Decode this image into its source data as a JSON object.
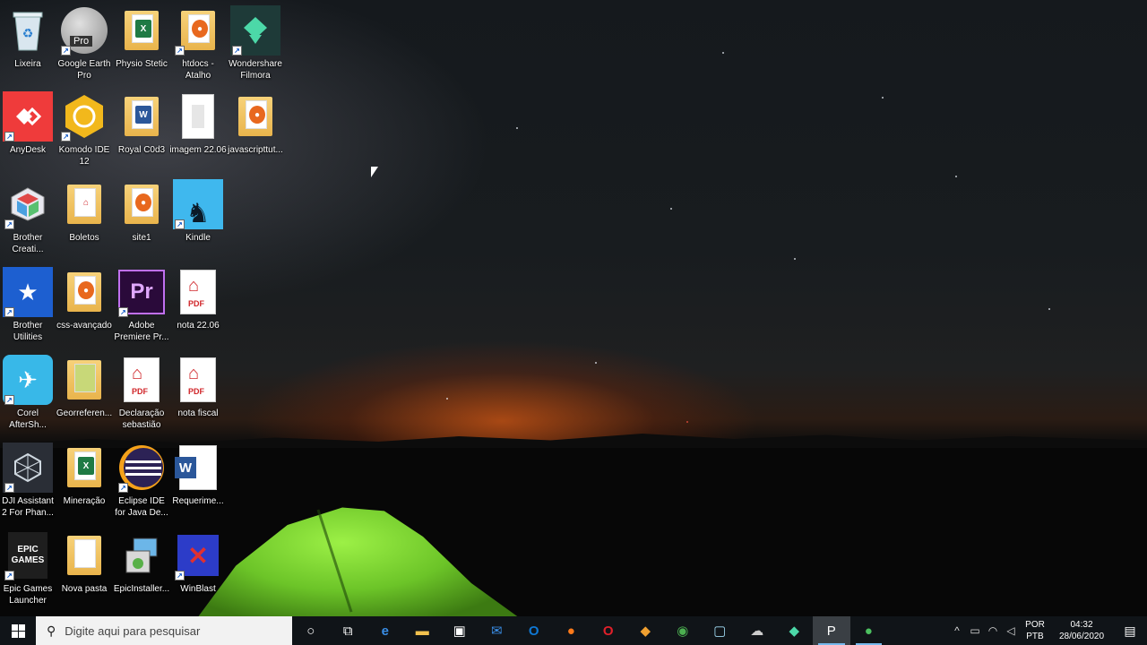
{
  "desktop": {
    "icons": [
      {
        "label": "Lixeira",
        "icon": "recycle-bin-icon"
      },
      {
        "label": "Google Earth Pro",
        "icon": "google-earth-icon",
        "badge": "Pro"
      },
      {
        "label": "Physio Stetic",
        "icon": "excel-folder-icon"
      },
      {
        "label": "htdocs - Atalho",
        "icon": "folder-shortcut-icon"
      },
      {
        "label": "Wondershare Filmora",
        "icon": "filmora-icon"
      },
      {
        "label": "AnyDesk",
        "icon": "anydesk-icon"
      },
      {
        "label": "Komodo IDE 12",
        "icon": "komodo-icon"
      },
      {
        "label": "Royal C0d3",
        "icon": "word-folder-icon"
      },
      {
        "label": "imagem 22.06",
        "icon": "image-file-icon"
      },
      {
        "label": "javascripttut...",
        "icon": "firefox-folder-icon"
      },
      {
        "label": "Brother Creati...",
        "icon": "brother-creative-icon"
      },
      {
        "label": "Boletos",
        "icon": "pdf-folder-icon"
      },
      {
        "label": "site1",
        "icon": "firefox-folder-icon"
      },
      {
        "label": "Kindle",
        "icon": "kindle-icon"
      },
      {
        "label": "Brother Utilities",
        "icon": "brother-utilities-icon"
      },
      {
        "label": "css-avançado",
        "icon": "firefox-folder-icon"
      },
      {
        "label": "Adobe Premiere Pr...",
        "icon": "premiere-icon",
        "badge": "Pr"
      },
      {
        "label": "nota 22.06",
        "icon": "pdf-icon"
      },
      {
        "label": "Corel AfterSh...",
        "icon": "corel-aftershot-icon"
      },
      {
        "label": "Georreferen...",
        "icon": "folder-icon"
      },
      {
        "label": "Declaração sebastião",
        "icon": "pdf-icon"
      },
      {
        "label": "nota fiscal",
        "icon": "pdf-icon"
      },
      {
        "label": "DJI Assistant 2 For Phan...",
        "icon": "dji-icon"
      },
      {
        "label": "Mineração",
        "icon": "excel-folder-icon"
      },
      {
        "label": "Eclipse IDE for Java De...",
        "icon": "eclipse-icon"
      },
      {
        "label": "Requerime...",
        "icon": "word-doc-icon"
      },
      {
        "label": "Epic Games Launcher",
        "icon": "epic-games-icon",
        "badge": "EPIC GAMES"
      },
      {
        "label": "Nova pasta",
        "icon": "folder-icon"
      },
      {
        "label": "EpicInstaller...",
        "icon": "installer-icon"
      },
      {
        "label": "WinBlast",
        "icon": "winblast-icon"
      }
    ],
    "pdf_text": "PDF"
  },
  "taskbar": {
    "search_placeholder": "Digite aqui para pesquisar",
    "apps": [
      {
        "name": "cortana-button",
        "glyph": "○"
      },
      {
        "name": "task-view-button",
        "glyph": "⧉"
      },
      {
        "name": "edge-button",
        "glyph": "e"
      },
      {
        "name": "file-explorer-button",
        "glyph": "▬"
      },
      {
        "name": "store-button",
        "glyph": "▣"
      },
      {
        "name": "mail-button",
        "glyph": "✉"
      },
      {
        "name": "outlook-button",
        "glyph": "O"
      },
      {
        "name": "firefox-button",
        "glyph": "●"
      },
      {
        "name": "opera-button",
        "glyph": "O"
      },
      {
        "name": "image-app-button",
        "glyph": "◆"
      },
      {
        "name": "chrome-button",
        "glyph": "◉"
      },
      {
        "name": "app-button",
        "glyph": "▢"
      },
      {
        "name": "network-app-button",
        "glyph": "☁"
      },
      {
        "name": "filmora-button",
        "glyph": "◆"
      },
      {
        "name": "powerpoint-button",
        "glyph": "P"
      },
      {
        "name": "green-app-button",
        "glyph": "●"
      }
    ],
    "tray": {
      "chevron": "^",
      "language_top": "POR",
      "language_bottom": "PTB",
      "time": "04:32",
      "date": "28/06/2020",
      "notification_glyph": "▤"
    }
  }
}
